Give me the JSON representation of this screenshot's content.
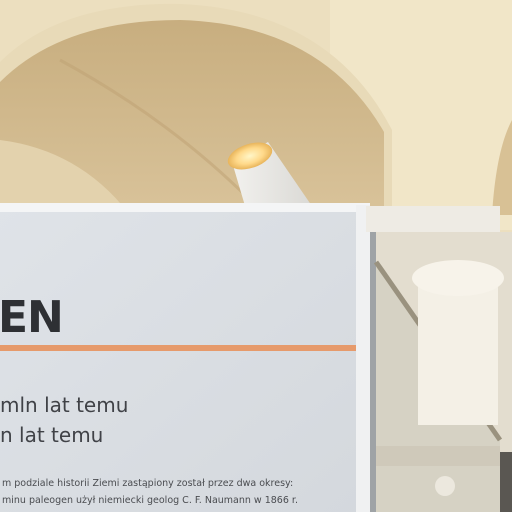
{
  "panel": {
    "heading": "EN",
    "line_1": "mln lat temu",
    "line_2": "n lat temu",
    "small_1": "m podziale historii Ziemi zastąpiony został przez dwa okresy:",
    "small_2": "minu paleogen użył niemiecki geolog C. F. Naumann w 1866 r."
  },
  "colors": {
    "vault": "#d2b98c",
    "wall": "#efe3c4",
    "panel": "#dde1e6",
    "accent_stripe": "#e79a6a"
  }
}
